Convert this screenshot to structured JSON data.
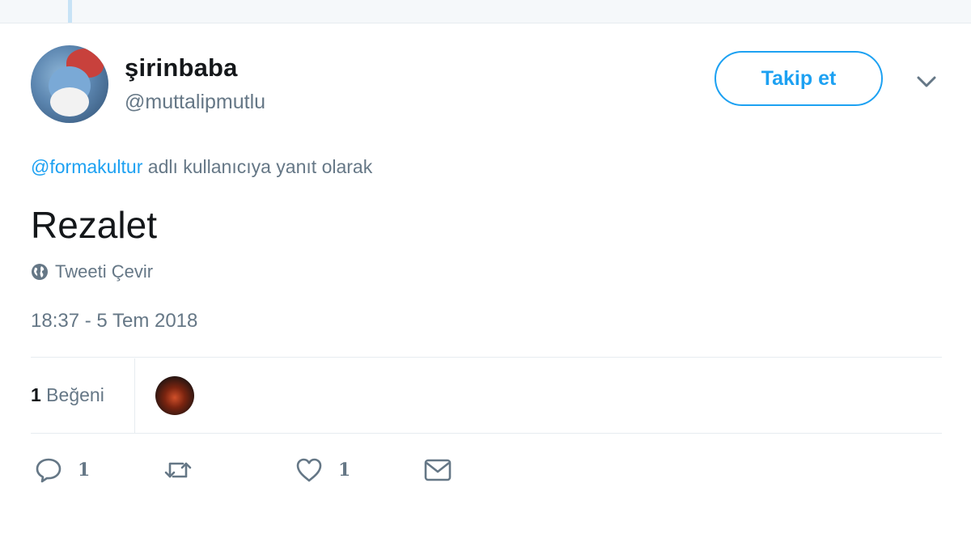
{
  "tweet": {
    "display_name": "şirinbaba",
    "handle": "@muttalipmutlu",
    "follow_label": "Takip et",
    "reply_mention": "@formakultur",
    "reply_suffix": " adlı kullanıcıya yanıt olarak",
    "text": "Rezalet",
    "translate_label": "Tweeti Çevir",
    "timestamp": "18:37 - 5 Tem 2018"
  },
  "stats": {
    "likes_count": "1",
    "likes_label": " Beğeni"
  },
  "actions": {
    "reply_count": "1",
    "retweet_count": "",
    "like_count": "1"
  },
  "icons": {
    "avatar": "smurf-avatar",
    "caret": "chevron-down-icon",
    "globe": "globe-icon",
    "reply": "reply-icon",
    "retweet": "retweet-icon",
    "like": "heart-icon",
    "dm": "envelope-icon"
  },
  "colors": {
    "accent": "#1da1f2",
    "secondary_text": "#657786",
    "divider": "#e6ecf0"
  }
}
